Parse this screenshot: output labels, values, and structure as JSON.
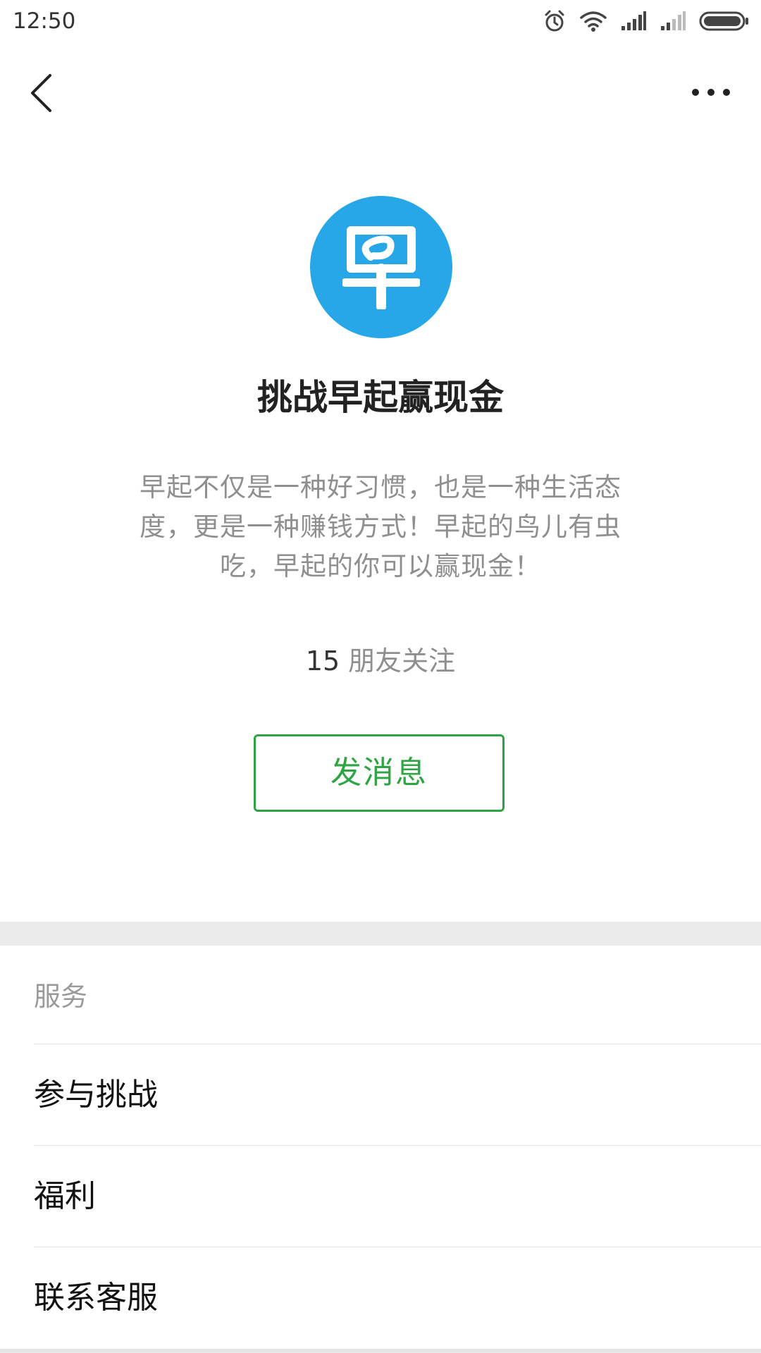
{
  "status_bar": {
    "time": "12:50",
    "icons": [
      "alarm-icon",
      "wifi-icon",
      "signal-icon",
      "signal-weak-icon",
      "battery-icon"
    ]
  },
  "nav": {
    "back_icon": "chevron-left-icon",
    "more_icon": "more-dots-icon"
  },
  "profile": {
    "avatar_glyph": "早",
    "name": "挑战早起赢现金",
    "description": "早起不仅是一种好习惯，也是一种生活态度，更是一种赚钱方式！早起的鸟儿有虫吃，早起的你可以赢现金！",
    "followers_count": "15",
    "followers_label": "朋友关注",
    "message_button": "发消息"
  },
  "services": {
    "header": "服务",
    "items": [
      {
        "label": "参与挑战"
      },
      {
        "label": "福利"
      },
      {
        "label": "联系客服"
      }
    ]
  },
  "colors": {
    "avatar_bg": "#27a7e8",
    "accent_green": "#2ea543",
    "separator": "#ebebeb",
    "secondary_text": "#8f8f8f"
  }
}
